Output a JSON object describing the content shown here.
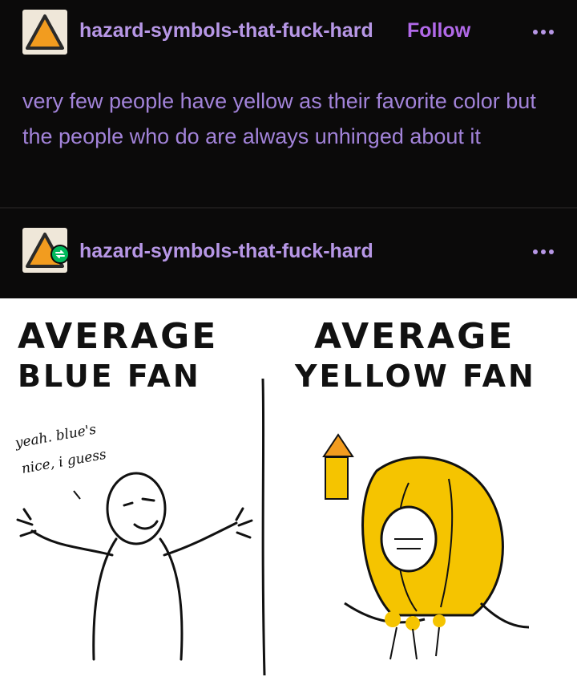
{
  "post": {
    "username": "hazard-symbols-that-fuck-hard",
    "follow_label": "Follow",
    "text": "very few people have yellow as their favorite color but the people who do are always unhinged about it"
  },
  "reblog": {
    "username": "hazard-symbols-that-fuck-hard"
  },
  "comic": {
    "left_title_line1": "AVERAGE",
    "left_title_line2": "BLUE FAN",
    "right_title_line1": "AVERAGE",
    "right_title_line2": "YELLOW FAN",
    "speech_line1": "yeah. blue's",
    "speech_line2": "nice, i guess"
  },
  "colors": {
    "background": "#0b0a0a",
    "username": "#b797e6",
    "follow": "#b169e8",
    "text": "#a283d9",
    "reblog_badge": "#00b85c",
    "hazard_orange": "#f29c1f",
    "yellow": "#f5c400"
  },
  "icons": [
    "hazard-triangle-icon",
    "reblog-icon",
    "more-options-icon"
  ]
}
